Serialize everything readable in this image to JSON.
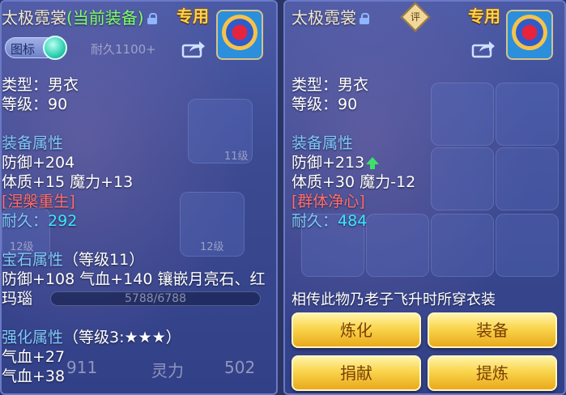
{
  "left": {
    "title_name": "太极霓裳",
    "title_status": "(当前装备)",
    "exclusive": "专用",
    "toggle_label": "图标",
    "type_line": "类型：男衣",
    "level_line": "等级：90",
    "equip_attr_header": "装备属性",
    "defense_line": "防御+204",
    "stats_line": "体质+15 魔力+13",
    "special_effect": "[涅槃重生]",
    "durability_label": "耐久：",
    "durability_value": "292",
    "gem_header": "宝石属性",
    "gem_level": "（等级11）",
    "gem_line1": "防御+108 气血+140 镶嵌月亮石、红",
    "gem_line2": "玛瑙",
    "enhance_header": "强化属性",
    "enhance_level": "（等级3:★★★）",
    "enhance_line1": "气血+27",
    "enhance_line2": "气血+38",
    "bg_text_durability": "耐久1100+",
    "bg_text_hp": "5788/6788",
    "bg_text_level11": "11级",
    "bg_text_level12a": "12级",
    "bg_text_level12b": "12级",
    "bg_text_911": "911",
    "bg_text_lingli": "灵力",
    "bg_text_502": "502"
  },
  "right": {
    "title_name": "太极霓裳",
    "ping_label": "评",
    "exclusive": "专用",
    "type_line": "类型：男衣",
    "level_line": "等级：90",
    "equip_attr_header": "装备属性",
    "defense_line": "防御+213",
    "stats_line": "体质+30 魔力-12",
    "special_effect": "[群体净心]",
    "durability_label": "耐久：",
    "durability_value": "484",
    "description": "相传此物乃老子飞升时所穿衣装",
    "btn_refine": "炼化",
    "btn_equip": "装备",
    "btn_donate": "捐献",
    "btn_extract": "提炼"
  },
  "colors": {
    "gold": "#f4c94a",
    "green": "#7cff6a",
    "blue": "#7fc9ff",
    "cyan": "#3de6ff",
    "red": "#ff6e6e"
  },
  "icons": [
    "lock-icon",
    "share-icon",
    "ping-badge-icon",
    "avatar-icon",
    "up-arrow-icon"
  ]
}
